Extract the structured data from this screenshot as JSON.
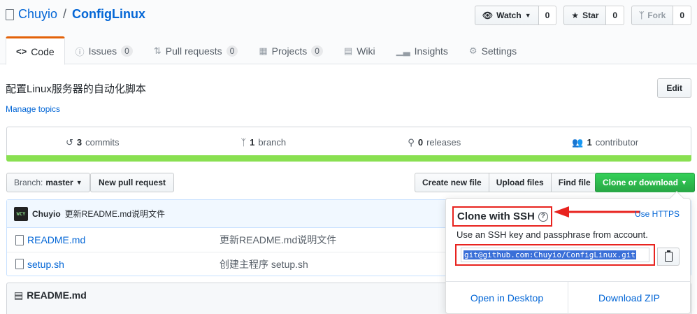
{
  "repo": {
    "owner": "Chuyio",
    "separator": "/",
    "name": "ConfigLinux"
  },
  "actions": {
    "watch": {
      "label": "Watch",
      "count": "0"
    },
    "star": {
      "label": "Star",
      "count": "0"
    },
    "fork": {
      "label": "Fork",
      "count": "0"
    }
  },
  "tabs": [
    {
      "label": "Code",
      "icon": "code-icon"
    },
    {
      "label": "Issues",
      "icon": "issue-icon",
      "count": "0"
    },
    {
      "label": "Pull requests",
      "icon": "pull-request-icon",
      "count": "0"
    },
    {
      "label": "Projects",
      "icon": "project-icon",
      "count": "0"
    },
    {
      "label": "Wiki",
      "icon": "book-icon"
    },
    {
      "label": "Insights",
      "icon": "graph-icon"
    },
    {
      "label": "Settings",
      "icon": "gear-icon"
    }
  ],
  "description": "配置Linux服务器的自动化脚本",
  "manage_topics": "Manage topics",
  "edit_label": "Edit",
  "summary": {
    "commits": {
      "num": "3",
      "label": "commits"
    },
    "branches": {
      "num": "1",
      "label": "branch"
    },
    "releases": {
      "num": "0",
      "label": "releases"
    },
    "contributors": {
      "num": "1",
      "label": "contributor"
    }
  },
  "lang_color": "#89e051",
  "file_nav": {
    "branch_label": "Branch:",
    "branch_value": "master",
    "new_pr": "New pull request",
    "create_file": "Create new file",
    "upload_files": "Upload files",
    "find_file": "Find file",
    "clone": "Clone or download"
  },
  "commit_tease": {
    "author": "Chuyio",
    "message": "更新README.md说明文件",
    "avatar_text": "WCY"
  },
  "files": [
    {
      "name": "README.md",
      "message": "更新README.md说明文件"
    },
    {
      "name": "setup.sh",
      "message": "创建主程序 setup.sh"
    }
  ],
  "readme_title": "README.md",
  "clone_popover": {
    "title": "Clone with SSH",
    "help_glyph": "?",
    "switch_link": "Use HTTPS",
    "help_text": "Use an SSH key and passphrase from account.",
    "url": "git@github.com:Chuyio/ConfigLinux.git",
    "open_desktop": "Open in Desktop",
    "download_zip": "Download ZIP"
  },
  "colors": {
    "accent_orange": "#e36209",
    "link": "#0366d6",
    "green": "#28a745",
    "annotation_red": "#e8231f"
  }
}
